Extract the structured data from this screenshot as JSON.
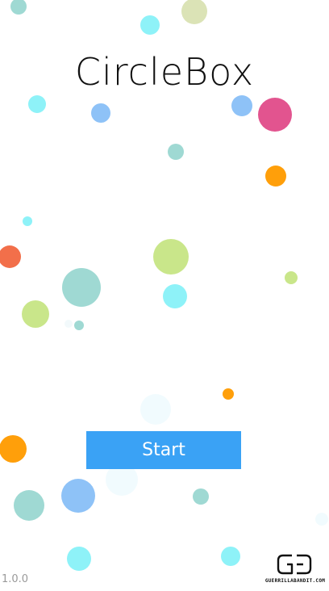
{
  "app": {
    "title": "CircleBox",
    "start_label": "Start",
    "version": "1.0.0",
    "studio_logo_text": "GUERRILLABANDIT.COM"
  },
  "colors": {
    "button": "#3aa2f5",
    "title_text": "#111111",
    "background": "#ffffff",
    "circle_palette": [
      "#9fd9d3",
      "#8ef2f8",
      "#dbe3b6",
      "#f2f9fb",
      "#8ec2f7",
      "#e2548f",
      "#ff9f0a",
      "#f26f4a",
      "#c9e68a",
      "#f1fbfe"
    ]
  }
}
